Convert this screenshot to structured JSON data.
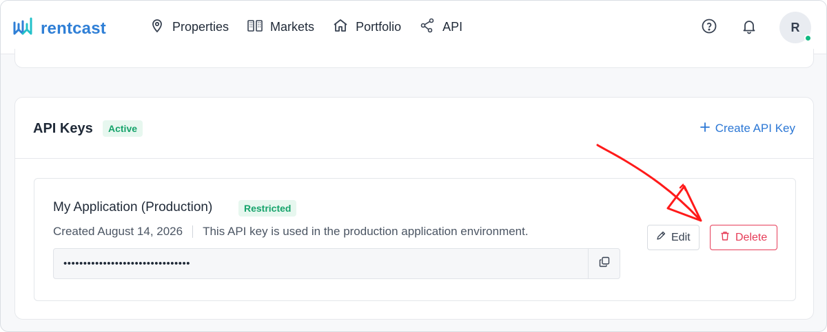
{
  "app": {
    "brand": "rentcast",
    "brand_color": "#2f7fd6"
  },
  "nav": {
    "items": [
      {
        "label": "Properties",
        "icon": "map-pin-icon"
      },
      {
        "label": "Markets",
        "icon": "buildings-icon"
      },
      {
        "label": "Portfolio",
        "icon": "home-icon"
      },
      {
        "label": "API",
        "icon": "share-nodes-icon"
      }
    ]
  },
  "header_right": {
    "help_icon": "help-circle-icon",
    "notifications_icon": "bell-icon",
    "avatar_initial": "R",
    "online_status_color": "#10b981"
  },
  "api_keys": {
    "title": "API Keys",
    "status_badge": "Active",
    "create_label": "Create API Key",
    "create_icon": "plus-icon",
    "key": {
      "name": "My Application (Production)",
      "badge": "Restricted",
      "created": "Created August 14, 2026",
      "description": "This API key is used in the production application environment.",
      "masked_value": "••••••••••••••••••••••••••••••••",
      "copy_icon": "copy-icon",
      "edit_label": "Edit",
      "edit_icon": "pencil-icon",
      "delete_label": "Delete",
      "delete_icon": "trash-icon"
    }
  },
  "colors": {
    "accent": "#2b77d5",
    "danger": "#e63b57",
    "success": "#16a36b",
    "annotation": "#ff1a1a"
  }
}
